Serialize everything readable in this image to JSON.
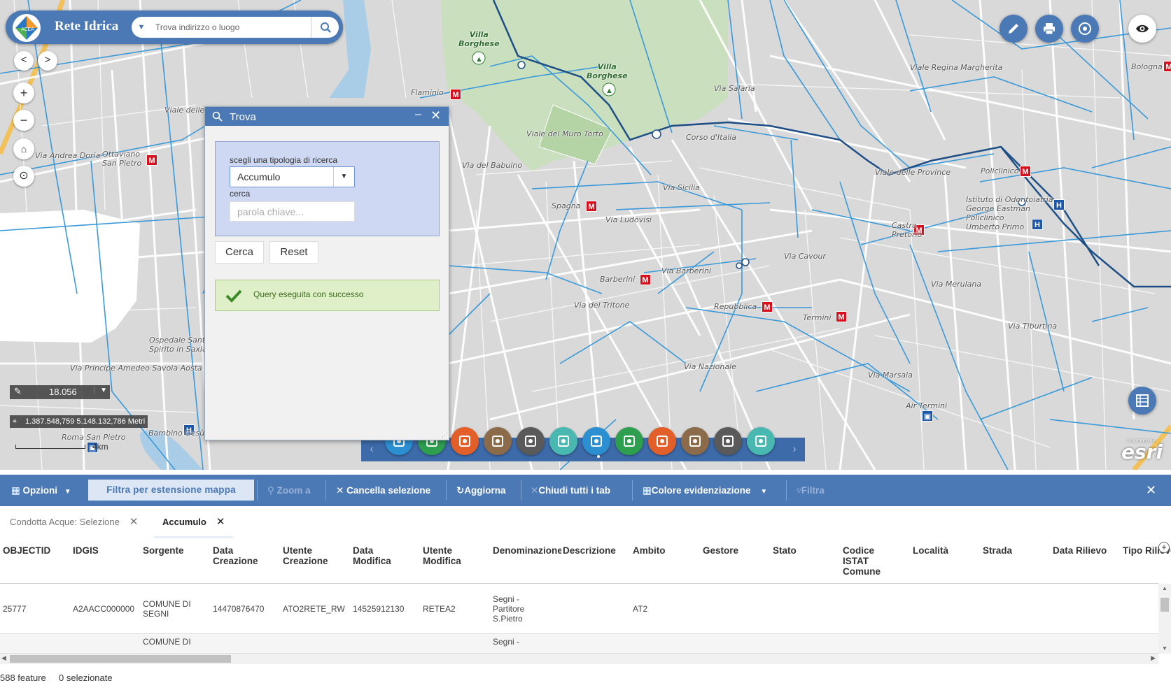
{
  "app": {
    "title": "Rete Idrica"
  },
  "search": {
    "placeholder": "Trova indirizzo o luogo"
  },
  "map": {
    "labels": [
      {
        "text": "Villa\nBorghese",
        "green": true
      },
      {
        "text": "Villa\nBorghese",
        "green": true
      },
      {
        "text": "Flaminio"
      },
      {
        "text": "Viale delle Milizie"
      },
      {
        "text": "Ottaviano\nSan Pietro"
      },
      {
        "text": "Via Andrea Doria"
      },
      {
        "text": "Viale del Muro Torto"
      },
      {
        "text": "Spagna"
      },
      {
        "text": "Via Ludovisi"
      },
      {
        "text": "Via Sicilia"
      },
      {
        "text": "Barberini"
      },
      {
        "text": "Via Barberini"
      },
      {
        "text": "Repubblica"
      },
      {
        "text": "Termini"
      },
      {
        "text": "Castro\nPretorio"
      },
      {
        "text": "Policlinico"
      },
      {
        "text": "Istituto di Odontoiatria\nGeorge Eastman\nPoliclinico\nUmberto Primo"
      },
      {
        "text": "Via Nazionale"
      },
      {
        "text": "Air Termini"
      },
      {
        "text": "Ospedale Santo\nSpirito in Saxia"
      },
      {
        "text": "Roma San Pietro"
      },
      {
        "text": "Bambino Gesù"
      },
      {
        "text": "Bologna"
      },
      {
        "text": "Via Salaria"
      },
      {
        "text": "Corso d'Italia"
      },
      {
        "text": "Via del Babuino"
      },
      {
        "text": "Via del Tritone"
      },
      {
        "text": "Via Cavour"
      },
      {
        "text": "Via Merulana"
      },
      {
        "text": "Viale Regina Margherita"
      },
      {
        "text": "Viale delle Province"
      },
      {
        "text": "Via Tiburtina"
      },
      {
        "text": "Via Marsala"
      },
      {
        "text": "Via Principe Amedeo Savoia Aosta"
      }
    ],
    "scale_value": "18.056",
    "coordinates": "1.387.548,759 5.148.132,786 Metri",
    "scalebar_label": "4km",
    "esri": "esri",
    "esri_powered": "POWERED BY",
    "colors": {
      "pipe_light": "#3a9ad9",
      "pipe_dark": "#1d4f86",
      "park": "#c9dfbd"
    }
  },
  "trova": {
    "title": "Trova",
    "tipo_label": "scegli una tipologia di ricerca",
    "tipo_value": "Accumulo",
    "cerca_label": "cerca",
    "cerca_placeholder": "parola chiave...",
    "btn_cerca": "Cerca",
    "btn_reset": "Reset",
    "status": "Query eseguita con successo"
  },
  "dock": {
    "buttons": [
      {
        "icon": "layers-icon",
        "color": "#2b8fd1"
      },
      {
        "icon": "legend-icon",
        "color": "#2e9e4f"
      },
      {
        "icon": "grid-icon",
        "color": "#e35f2a"
      },
      {
        "icon": "graduation-icon",
        "color": "#8b6b4a"
      },
      {
        "icon": "measure-search-icon",
        "color": "#5a5a5a"
      },
      {
        "icon": "document-icon",
        "color": "#49b8b0"
      },
      {
        "icon": "search-icon",
        "color": "#2b8fd1"
      },
      {
        "icon": "location-icon",
        "color": "#2e9e4f"
      },
      {
        "icon": "person-icon",
        "color": "#e35f2a"
      },
      {
        "icon": "map-book-icon",
        "color": "#8b6b4a"
      },
      {
        "icon": "download-icon",
        "color": "#5a5a5a"
      },
      {
        "icon": "pi-icon",
        "color": "#49b8b0"
      }
    ]
  },
  "attr_toolbar": {
    "opzioni": "Opzioni",
    "filtra": "Filtra per estensione mappa",
    "zoom": "Zoom a",
    "cancella": "Cancella selezione",
    "aggiorna": "Aggiorna",
    "chiudi": "Chiudi tutti i tab",
    "colore": "Colore evidenziazione",
    "filtra2": "Filtra"
  },
  "tabs": [
    {
      "label": "Condotta Acque: Selezione",
      "active": false
    },
    {
      "label": "Accumulo",
      "active": true
    }
  ],
  "table": {
    "columns": [
      "OBJECTID",
      "IDGIS",
      "Sorgente",
      "Data\nCreazione",
      "Utente\nCreazione",
      "Data\nModifica",
      "Utente\nModifica",
      "Denominazione",
      "Descrizione",
      "Ambito",
      "Gestore",
      "Stato",
      "Codice\nISTAT\nComune",
      "Località",
      "Strada",
      "Data Rilievo",
      "Tipo Rilievo"
    ],
    "rows": [
      [
        "25777",
        "A2AACC000000",
        "COMUNE DI\nSEGNI",
        "14470876470",
        "ATO2RETE_RW",
        "14525912130",
        "RETEA2",
        "Segni -\nPartitore\nS.Pietro",
        "",
        "AT2",
        "",
        "",
        "",
        "",
        "",
        "",
        ""
      ],
      [
        "",
        "",
        "COMUNE DI",
        "",
        "",
        "",
        "",
        "Segni -",
        "",
        "",
        "",
        "",
        "",
        "",
        "",
        "",
        ""
      ]
    ]
  },
  "footer": {
    "features": "588 feature",
    "selected": "0 selezionate"
  }
}
